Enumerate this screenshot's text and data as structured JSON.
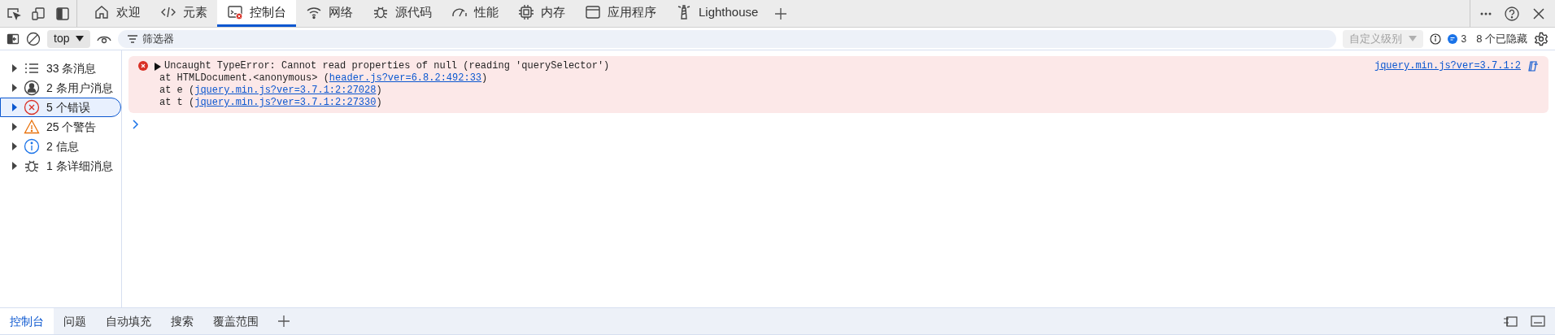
{
  "tabs": [
    {
      "label": "欢迎",
      "kind": "home",
      "selected": false
    },
    {
      "label": "元素",
      "kind": "code",
      "selected": false
    },
    {
      "label": "控制台",
      "kind": "console",
      "selected": true
    },
    {
      "label": "网络",
      "kind": "wifi",
      "selected": false
    },
    {
      "label": "源代码",
      "kind": "bug",
      "selected": false
    },
    {
      "label": "性能",
      "kind": "gauge",
      "selected": false
    },
    {
      "label": "内存",
      "kind": "chip",
      "selected": false
    },
    {
      "label": "应用程序",
      "kind": "window",
      "selected": false
    },
    {
      "label": "Lighthouse",
      "kind": "lighthouse",
      "selected": false
    }
  ],
  "toolbar": {
    "context": "top",
    "filter_placeholder": "筛选器",
    "level": "自定义级别",
    "issues_count": "3",
    "hidden": "8 个已隐藏"
  },
  "sidebar": {
    "items": [
      {
        "label": "33 条消息",
        "kind": "list",
        "selected": false
      },
      {
        "label": "2 条用户消息",
        "kind": "user",
        "selected": false
      },
      {
        "label": "5 个错误",
        "kind": "error",
        "selected": true
      },
      {
        "label": "25 个警告",
        "kind": "warning",
        "selected": false
      },
      {
        "label": "2 信息",
        "kind": "info",
        "selected": false
      },
      {
        "label": "1 条详细消息",
        "kind": "bug",
        "selected": false
      }
    ]
  },
  "console": {
    "error": {
      "message": "Uncaught TypeError: Cannot read properties of null (reading 'querySelector')",
      "source": "jquery.min.js?ver=3.7.1:2",
      "stack": [
        {
          "before": "at HTMLDocument.<anonymous> (",
          "link": "header.js?ver=6.8.2:492:33",
          "after": ")"
        },
        {
          "before": "at e (",
          "link": "jquery.min.js?ver=3.7.1:2:27028",
          "after": ")"
        },
        {
          "before": "at t (",
          "link": "jquery.min.js?ver=3.7.1:2:27330",
          "after": ")"
        }
      ]
    }
  },
  "drawer": {
    "tabs": [
      {
        "label": "控制台",
        "selected": true
      },
      {
        "label": "问题",
        "selected": false
      },
      {
        "label": "自动填充",
        "selected": false
      },
      {
        "label": "搜索",
        "selected": false
      },
      {
        "label": "覆盖范围",
        "selected": false
      }
    ]
  }
}
